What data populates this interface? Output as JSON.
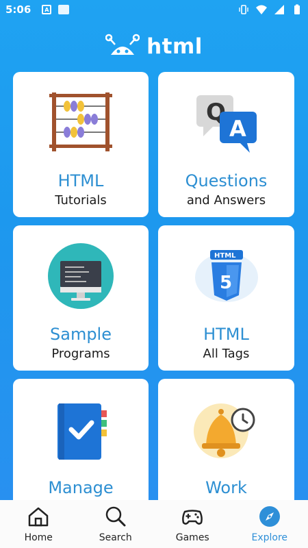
{
  "status_bar": {
    "time": "5:06",
    "notif_letter": "A"
  },
  "header": {
    "title": "html"
  },
  "cards": [
    {
      "title": "HTML",
      "subtitle": "Tutorials",
      "icon": "abacus-icon"
    },
    {
      "title": "Questions",
      "subtitle": "and Answers",
      "icon": "qa-icon"
    },
    {
      "title": "Sample",
      "subtitle": "Programs",
      "icon": "computer-icon"
    },
    {
      "title": "HTML",
      "subtitle": "All Tags",
      "icon": "html5-icon"
    },
    {
      "title": "Manage",
      "subtitle": "",
      "icon": "notebook-check-icon"
    },
    {
      "title": "Work",
      "subtitle": "",
      "icon": "bell-clock-icon"
    }
  ],
  "bottom_nav": {
    "items": [
      {
        "label": "Home",
        "icon": "home-icon",
        "active": false
      },
      {
        "label": "Search",
        "icon": "search-icon",
        "active": false
      },
      {
        "label": "Games",
        "icon": "gamepad-icon",
        "active": false
      },
      {
        "label": "Explore",
        "icon": "compass-icon",
        "active": true
      }
    ]
  },
  "colors": {
    "background": "#1fa3f2",
    "card": "#ffffff",
    "accent": "#2d8fd2",
    "nav_active": "#2e8fd8"
  }
}
